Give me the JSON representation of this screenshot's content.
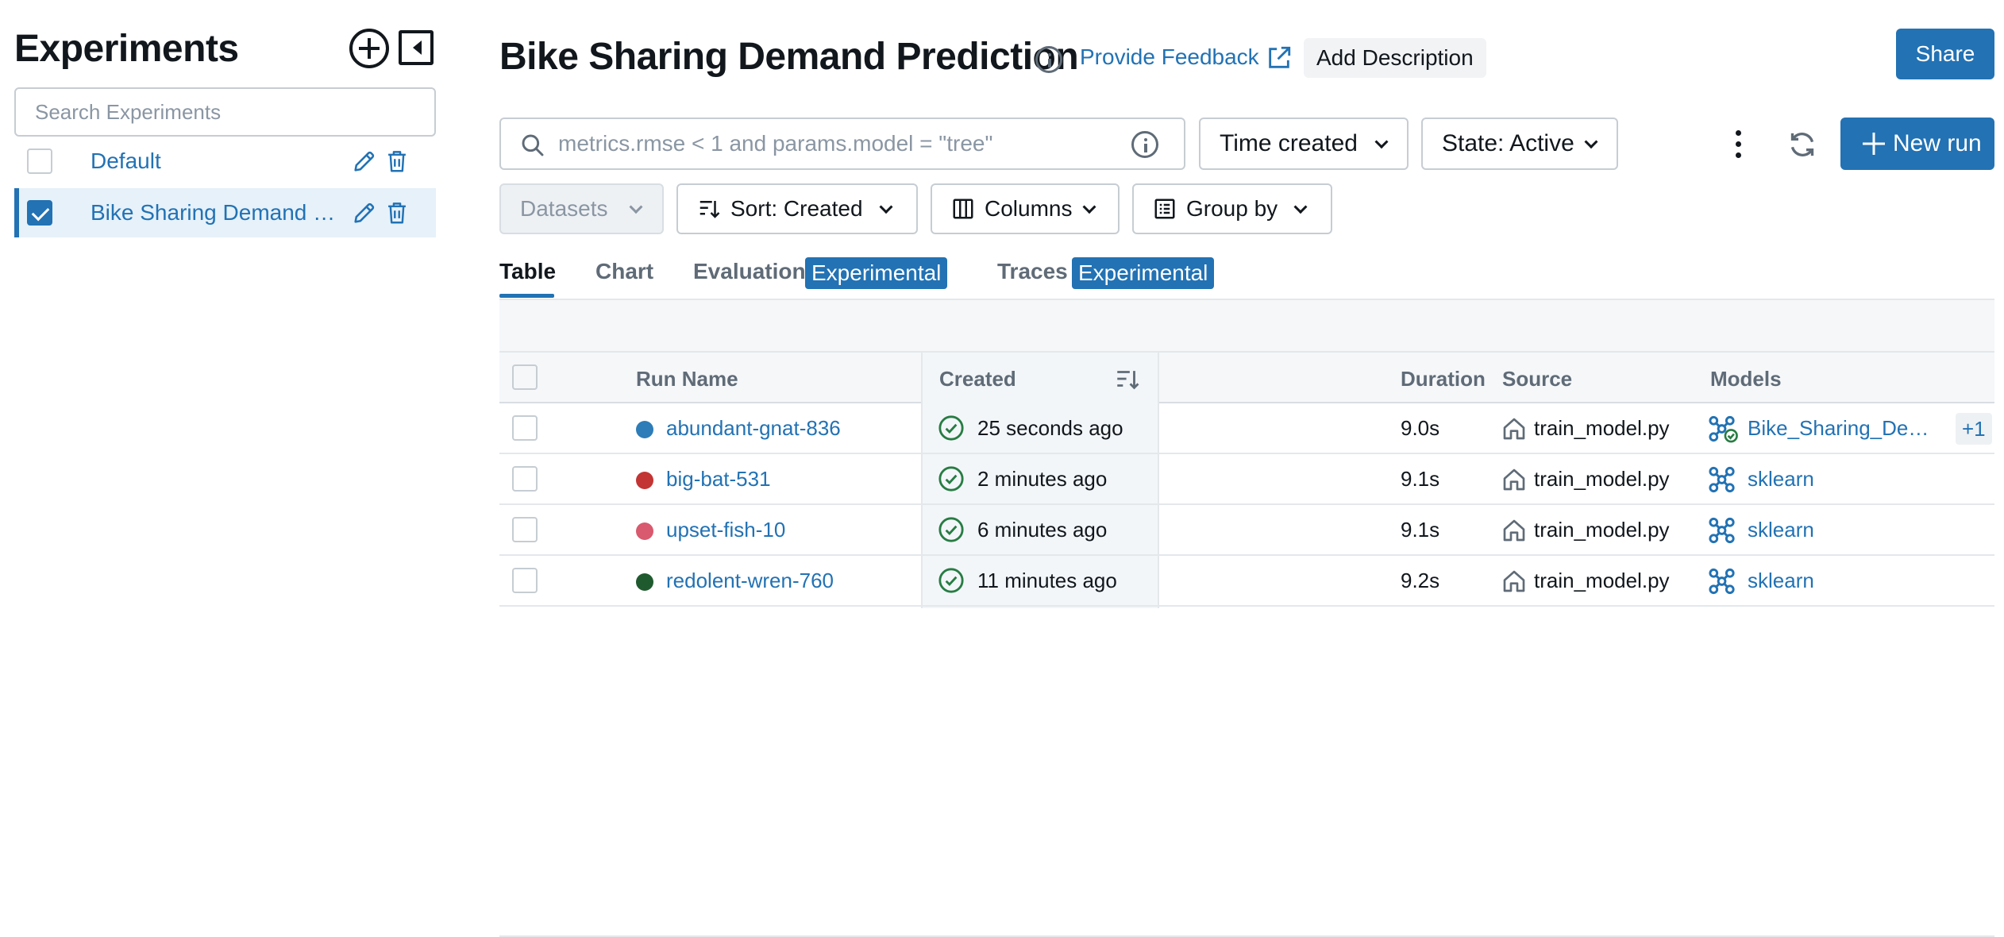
{
  "colors": {
    "accent": "#2272b4",
    "success": "#277c43",
    "run_blue": "#2e7cb8",
    "run_red": "#c33434",
    "run_pink": "#d9596e",
    "run_darkgreen": "#1f5a2e"
  },
  "sidebar": {
    "title": "Experiments",
    "add_icon": "plus-circle-icon",
    "collapse_icon": "sidebar-collapse-icon",
    "search_placeholder": "Search Experiments",
    "experiments": [
      {
        "label": "Default",
        "checked": false,
        "selected": false
      },
      {
        "label": "Bike Sharing Demand Prediction",
        "checked": true,
        "selected": true
      }
    ]
  },
  "header": {
    "title": "Bike Sharing Demand Prediction",
    "feedback_label": "Provide Feedback",
    "add_description_label": "Add Description",
    "share_label": "Share"
  },
  "toolbar": {
    "search_placeholder": "metrics.rmse < 1 and params.model = \"tree\"",
    "time_created_label": "Time created",
    "state_label": "State: Active",
    "new_run_label": "New run",
    "datasets_label": "Datasets",
    "sort_label": "Sort: Created",
    "columns_label": "Columns",
    "group_by_label": "Group by"
  },
  "tabs": [
    {
      "label": "Table",
      "active": true
    },
    {
      "label": "Chart",
      "active": false
    },
    {
      "label": "Evaluation",
      "badge": "Experimental",
      "active": false
    },
    {
      "label": "Traces",
      "badge": "Experimental",
      "active": false
    }
  ],
  "table": {
    "columns": [
      "Run Name",
      "Created",
      "Duration",
      "Source",
      "Models"
    ],
    "rows": [
      {
        "name": "abundant-gnat-836",
        "color": "#2e7cb8",
        "created": "25 seconds ago",
        "duration": "9.0s",
        "source": "train_model.py",
        "model": "Bike_Sharing_Demand_Model",
        "extra": "+1"
      },
      {
        "name": "big-bat-531",
        "color": "#c33434",
        "created": "2 minutes ago",
        "duration": "9.1s",
        "source": "train_model.py",
        "model": "sklearn"
      },
      {
        "name": "upset-fish-10",
        "color": "#d9596e",
        "created": "6 minutes ago",
        "duration": "9.1s",
        "source": "train_model.py",
        "model": "sklearn"
      },
      {
        "name": "redolent-wren-760",
        "color": "#1f5a2e",
        "created": "11 minutes ago",
        "duration": "9.2s",
        "source": "train_model.py",
        "model": "sklearn"
      }
    ]
  }
}
